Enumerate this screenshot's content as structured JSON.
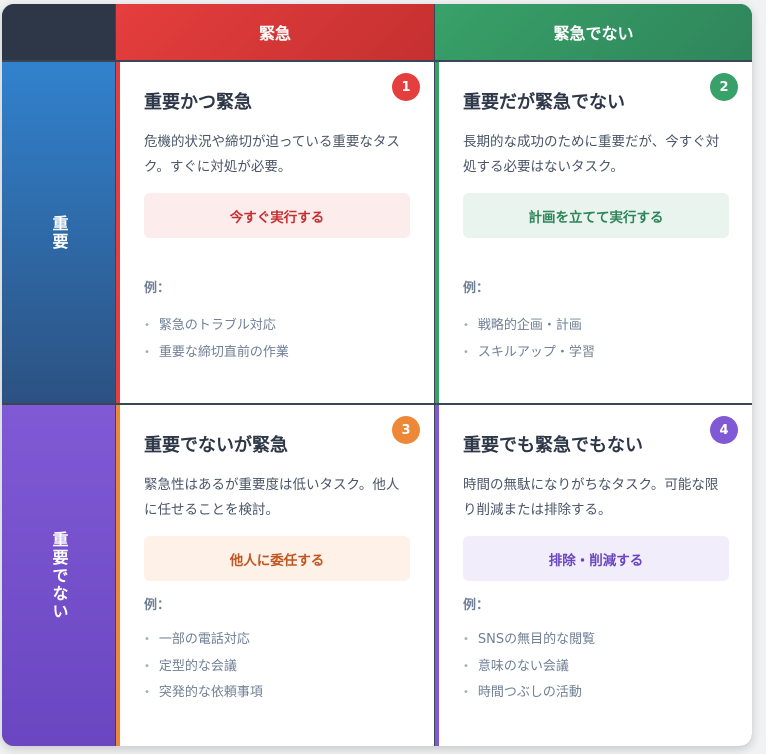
{
  "columns": {
    "urgent": "緊急",
    "not_urgent": "緊急でない"
  },
  "rows": {
    "important": "重要",
    "not_important": "重要でない"
  },
  "colors": {
    "q1": "#e53e3e",
    "q2": "#38a169",
    "q3": "#ed8936",
    "q4": "#805ad5",
    "important_row": "#2b6cb0",
    "not_important_row": "#6b46c1"
  },
  "quadrants": [
    {
      "number": "1",
      "title": "重要かつ緊急",
      "description": "危機的状況や締切が迫っている重要なタスク。すぐに対処が必要。",
      "action": "今すぐ実行する",
      "examples_label": "例：",
      "examples": [
        "緊急のトラブル対応",
        "重要な締切直前の作業"
      ]
    },
    {
      "number": "2",
      "title": "重要だが緊急でない",
      "description": "長期的な成功のために重要だが、今すぐ対処する必要はないタスク。",
      "action": "計画を立てて実行する",
      "examples_label": "例：",
      "examples": [
        "戦略的企画・計画",
        "スキルアップ・学習"
      ]
    },
    {
      "number": "3",
      "title": "重要でないが緊急",
      "description": "緊急性はあるが重要度は低いタスク。他人に任せることを検討。",
      "action": "他人に委任する",
      "examples_label": "例：",
      "examples": [
        "一部の電話対応",
        "定型的な会議",
        "突発的な依頼事項"
      ]
    },
    {
      "number": "4",
      "title": "重要でも緊急でもない",
      "description": "時間の無駄になりがちなタスク。可能な限り削減または排除する。",
      "action": "排除・削減する",
      "examples_label": "例：",
      "examples": [
        "SNSの無目的な閲覧",
        "意味のない会議",
        "時間つぶしの活動"
      ]
    }
  ]
}
